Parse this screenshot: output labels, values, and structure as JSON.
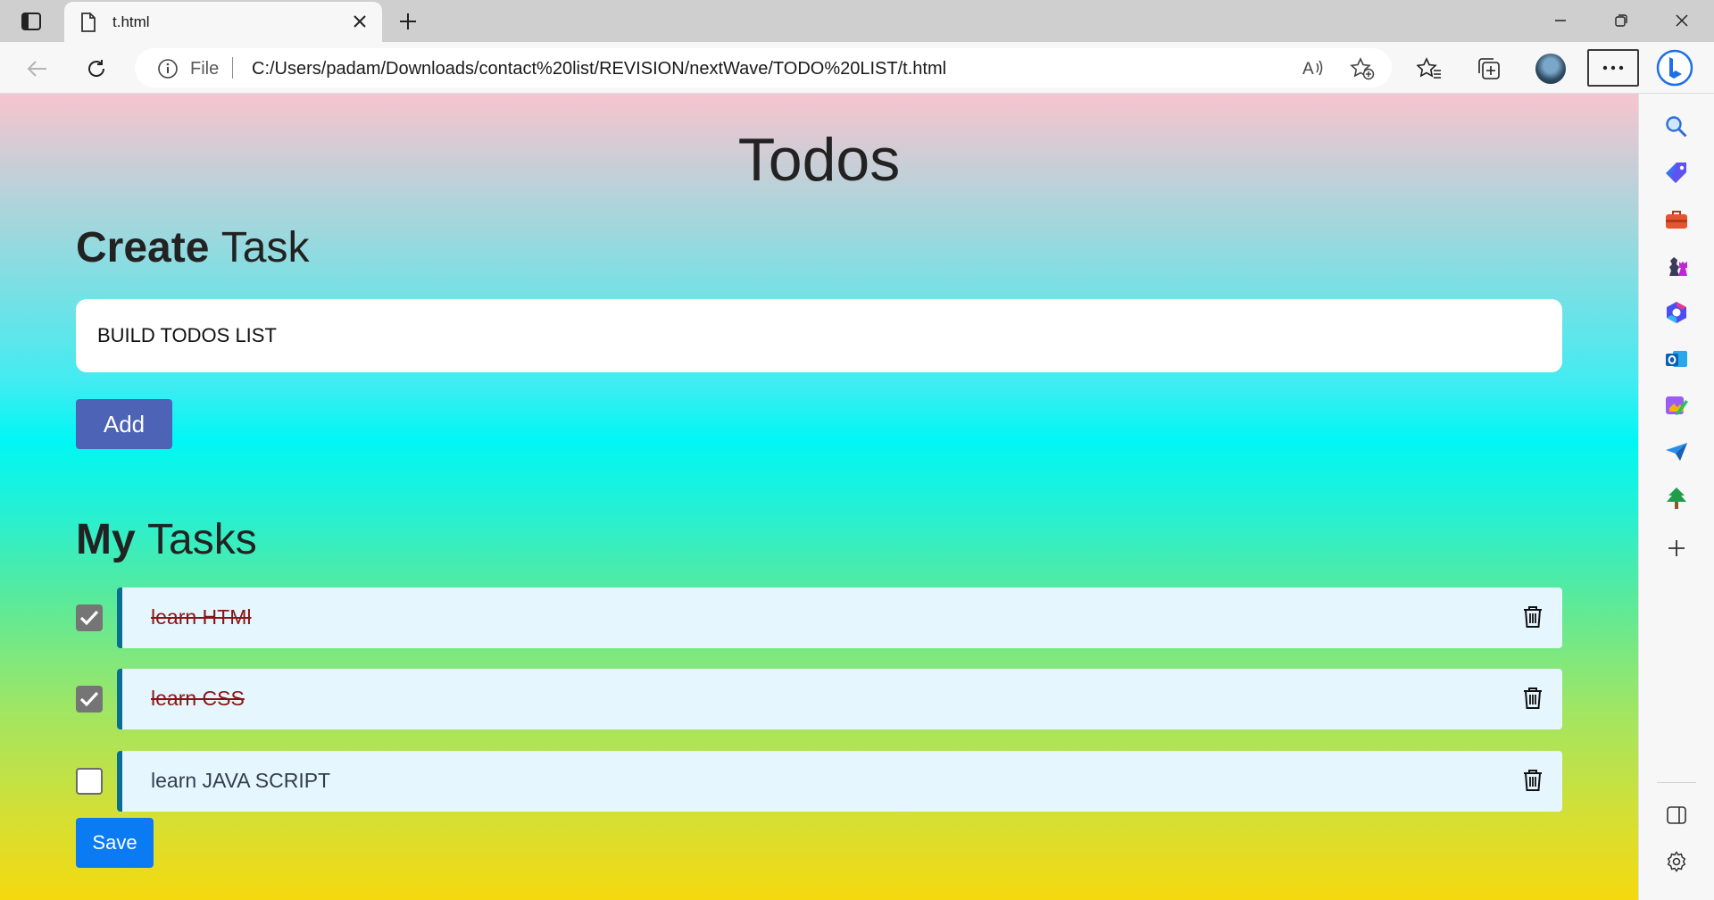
{
  "browser": {
    "tab": {
      "title": "t.html"
    },
    "address": {
      "scheme": "File",
      "url": "C:/Users/padam/Downloads/contact%20list/REVISION/nextWave/TODO%20LIST/t.html"
    }
  },
  "sidebar": {
    "items": [
      "search-icon",
      "shopping-tag-icon",
      "tools-icon",
      "games-icon",
      "microsoft-365-icon",
      "outlook-icon",
      "designer-icon",
      "send-icon",
      "tree-icon",
      "add-icon"
    ]
  },
  "page": {
    "heading": "Todos",
    "create": {
      "bold": "Create",
      "light": "Task"
    },
    "input": {
      "value": "BUILD TODOS LIST"
    },
    "add_label": "Add",
    "tasks_heading": {
      "bold": "My",
      "light": "Tasks"
    },
    "todos": [
      {
        "label": "learn HTMl",
        "checked": true
      },
      {
        "label": "learn CSS",
        "checked": true
      },
      {
        "label": "learn JAVA SCRIPT",
        "checked": false
      }
    ],
    "save_label": "Save"
  },
  "colors": {
    "add_button": "#4c63b6",
    "save_button": "#0b7bf4",
    "todo_card": "#e6f6ff",
    "todo_border": "#096f92",
    "done_text": "#8a1414"
  }
}
